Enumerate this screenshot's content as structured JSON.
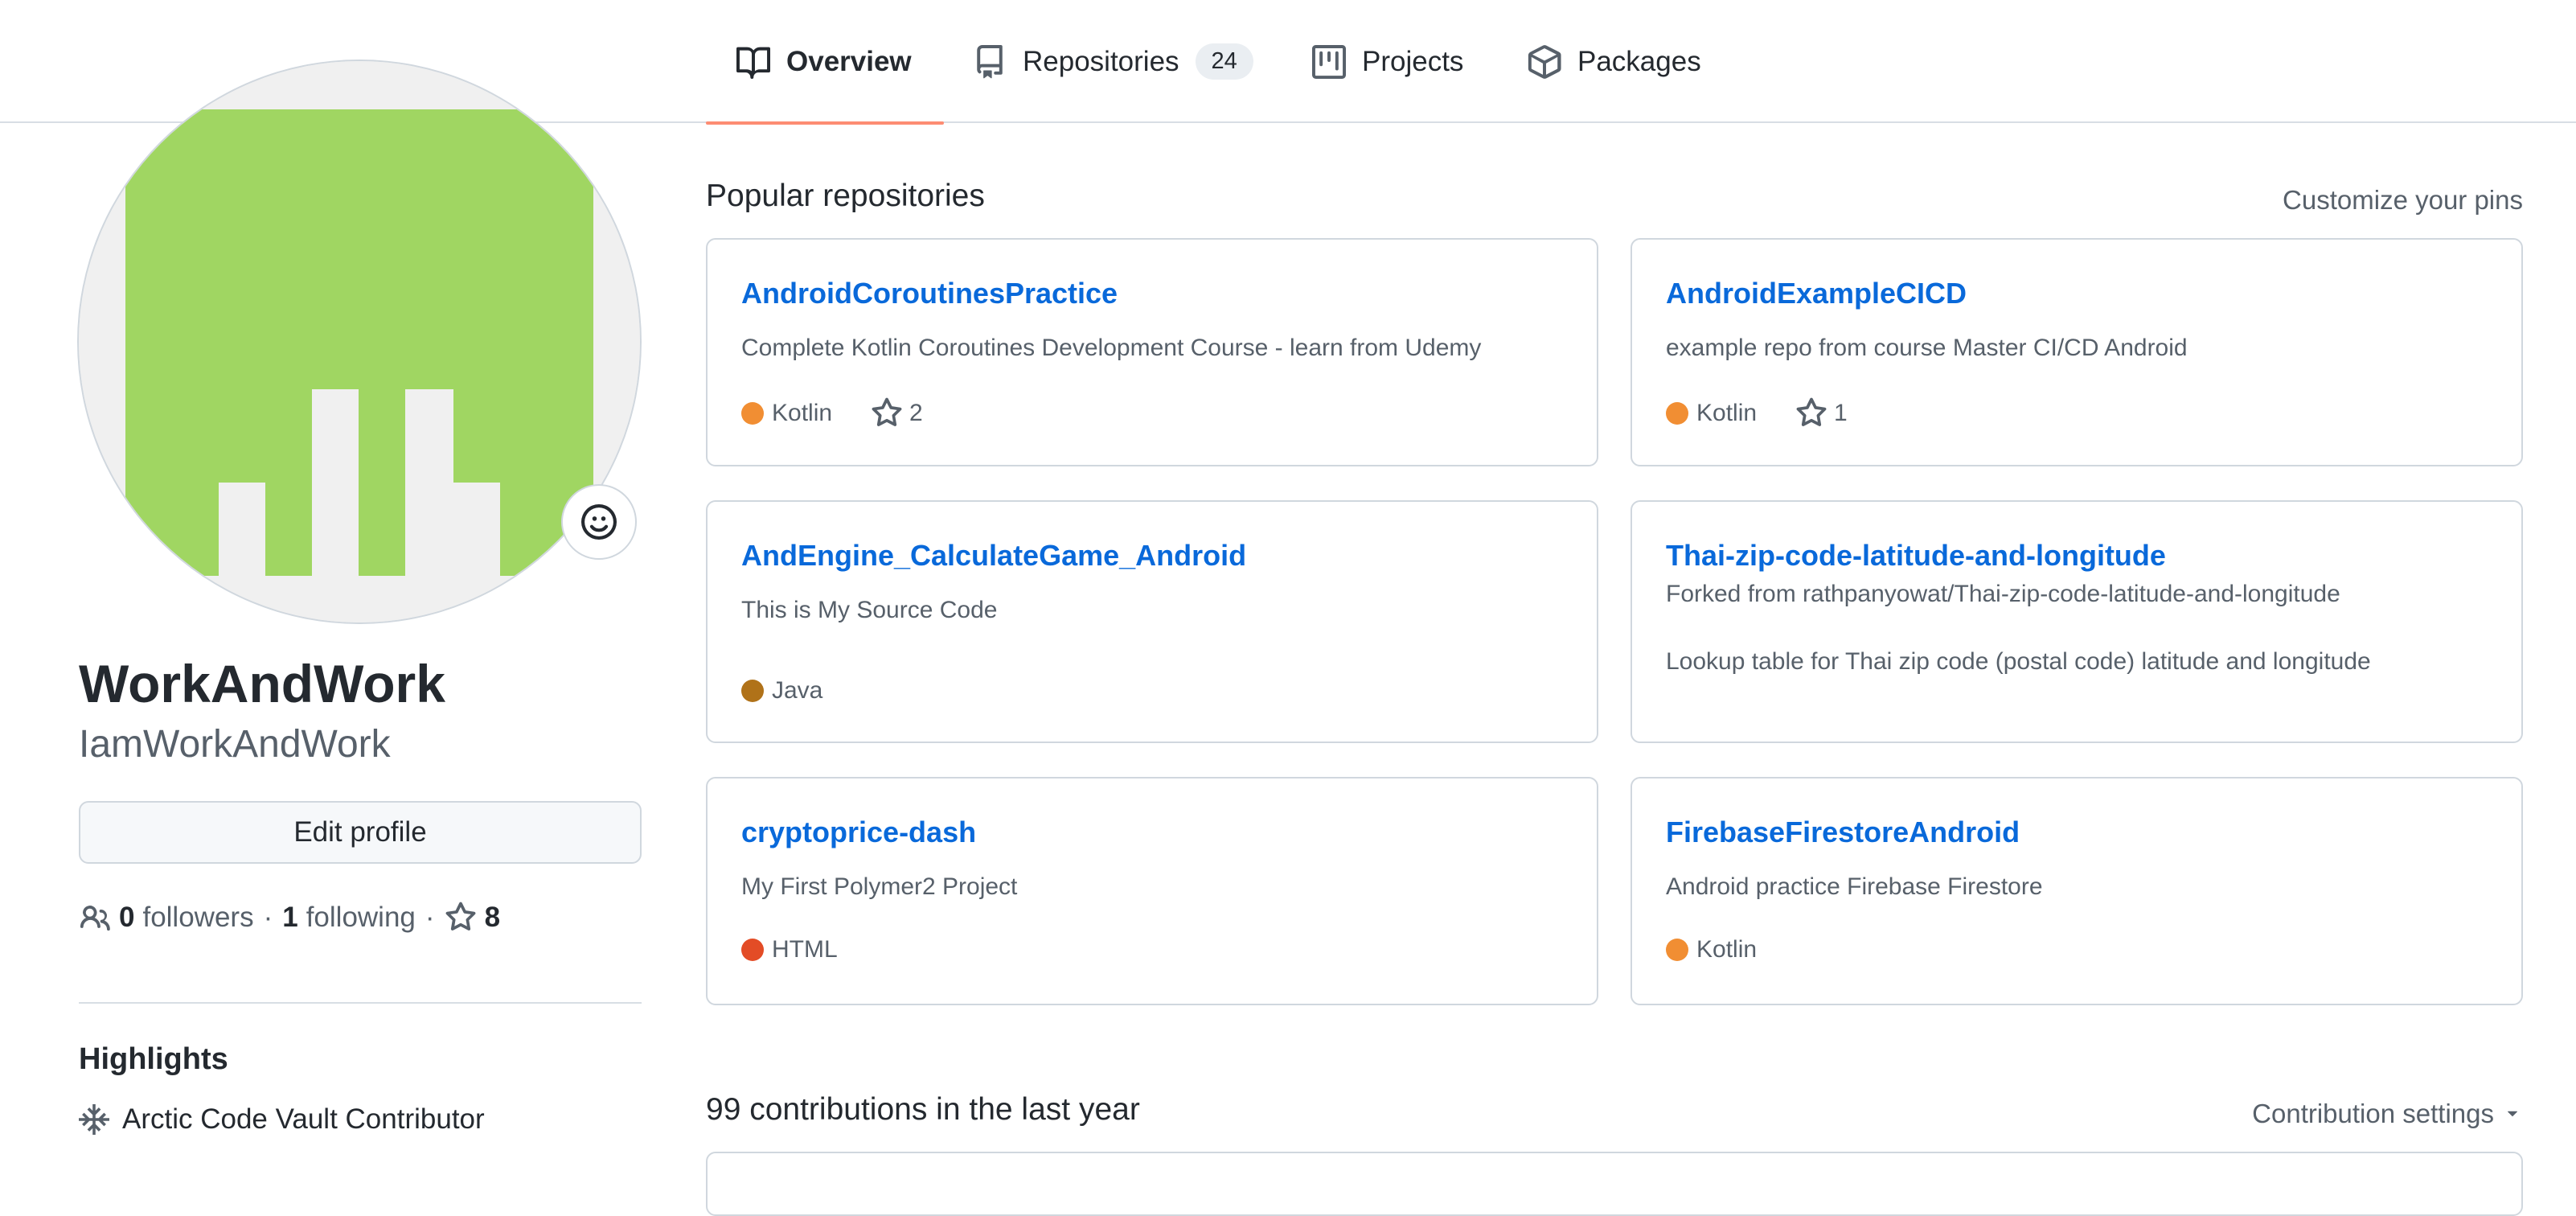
{
  "tabs": [
    {
      "label": "Overview",
      "icon": "book-icon",
      "active": true
    },
    {
      "label": "Repositories",
      "icon": "repo-icon",
      "count": "24"
    },
    {
      "label": "Projects",
      "icon": "project-icon"
    },
    {
      "label": "Packages",
      "icon": "package-icon"
    }
  ],
  "profile": {
    "fullname": "WorkAndWork",
    "username": "IamWorkAndWork",
    "avatar_color": "#a0d662",
    "edit_label": "Edit profile",
    "followers_count": "0",
    "followers_label": "followers",
    "following_count": "1",
    "following_label": "following",
    "stars_count": "8",
    "dot": "·"
  },
  "highlights": {
    "title": "Highlights",
    "items": [
      "Arctic Code Vault Contributor"
    ]
  },
  "popular": {
    "title": "Popular repositories",
    "customize_label": "Customize your pins",
    "repos": [
      {
        "name": "AndroidCoroutinesPractice",
        "description": "Complete Kotlin Coroutines Development Course - learn from Udemy",
        "language": "Kotlin",
        "language_color": "#F18E33",
        "stars": "2"
      },
      {
        "name": "AndroidExampleCICD",
        "description": "example repo from course Master CI/CD Android",
        "language": "Kotlin",
        "language_color": "#F18E33",
        "stars": "1"
      },
      {
        "name": "AndEngine_CalculateGame_Android",
        "description": "This is My Source Code",
        "language": "Java",
        "language_color": "#b07219"
      },
      {
        "name": "Thai-zip-code-latitude-and-longitude",
        "fork_note": "Forked from rathpanyowat/Thai-zip-code-latitude-and-longitude",
        "description": "Lookup table for Thai zip code (postal code) latitude and longitude"
      },
      {
        "name": "cryptoprice-dash",
        "description": "My First Polymer2 Project",
        "language": "HTML",
        "language_color": "#e34c26"
      },
      {
        "name": "FirebaseFirestoreAndroid",
        "description": "Android practice Firebase Firestore",
        "language": "Kotlin",
        "language_color": "#F18E33"
      }
    ]
  },
  "contributions": {
    "title": "99 contributions in the last year",
    "settings_label": "Contribution settings"
  }
}
